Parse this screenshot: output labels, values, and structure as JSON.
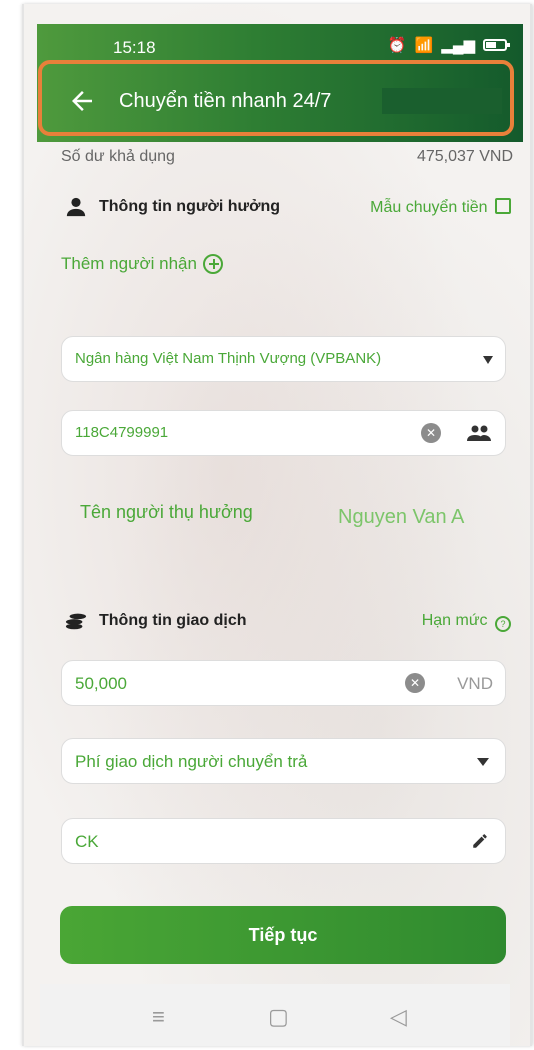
{
  "status_bar": {
    "time": "15:18"
  },
  "header": {
    "title": "Chuyển tiền nhanh 24/7"
  },
  "balance": {
    "label": "Số dư khả dụng",
    "value": "475,037 VND"
  },
  "beneficiary_section": {
    "title": "Thông tin người hưởng",
    "template_link": "Mẫu chuyển tiền",
    "add_recipient": "Thêm người nhận",
    "bank_value": "Ngân hàng Việt Nam Thịnh Vượng (VPBANK)",
    "account_number": "118C4799991",
    "name_label": "Tên người thụ hưởng",
    "name_value": "Nguyen Van A"
  },
  "transaction_section": {
    "title": "Thông tin giao dịch",
    "limit_link": "Hạn mức",
    "amount": "50,000",
    "currency": "VND",
    "fee_option": "Phí giao dịch người chuyển trả",
    "note": "CK"
  },
  "actions": {
    "continue_label": "Tiếp tục"
  },
  "colors": {
    "accent": "#4aa838",
    "header_dark": "#145a2c",
    "highlight": "#e8803a"
  },
  "icons": [
    "back-arrow-icon",
    "person-icon",
    "list-icon",
    "plus-circle-icon",
    "dropdown-icon",
    "clear-icon",
    "contacts-icon",
    "coins-icon",
    "help-circle-icon",
    "edit-pencil-icon"
  ]
}
